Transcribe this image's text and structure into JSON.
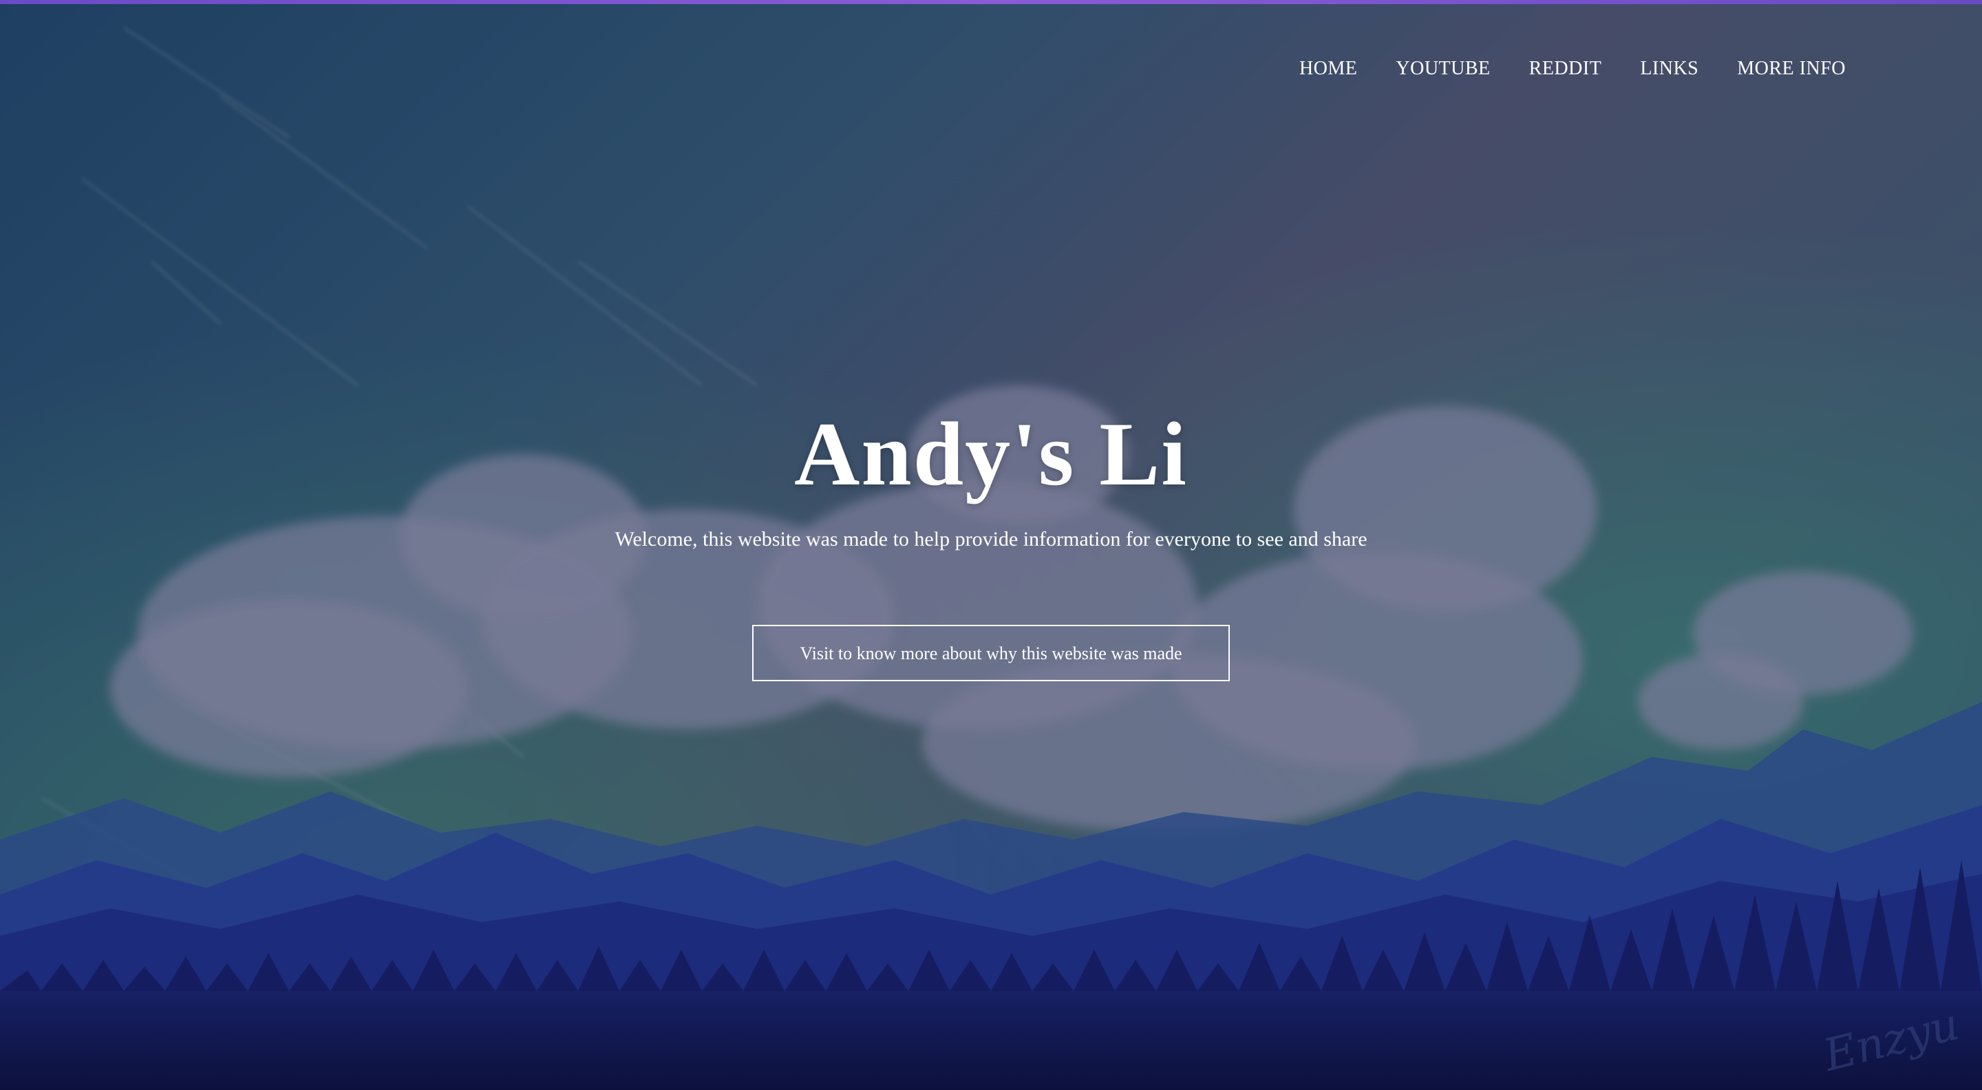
{
  "nav": {
    "items": [
      {
        "label": "HOME"
      },
      {
        "label": "YOUTUBE"
      },
      {
        "label": "REDDIT"
      },
      {
        "label": "LINKS"
      },
      {
        "label": "MORE INFO"
      }
    ]
  },
  "hero": {
    "title": "Andy's Li",
    "subtitle": "Welcome, this website was made to help provide information for everyone to see and share",
    "cta_label": "Visit to know more about why this website was made"
  },
  "colors": {
    "accent_bar": "#7a55d0",
    "sky_top": "#1c4a6e",
    "sky_mid": "#4a5470",
    "mountains": "#2a3f9a",
    "forest": "#0b1450"
  },
  "background": {
    "signature_text": "Enzyu"
  }
}
